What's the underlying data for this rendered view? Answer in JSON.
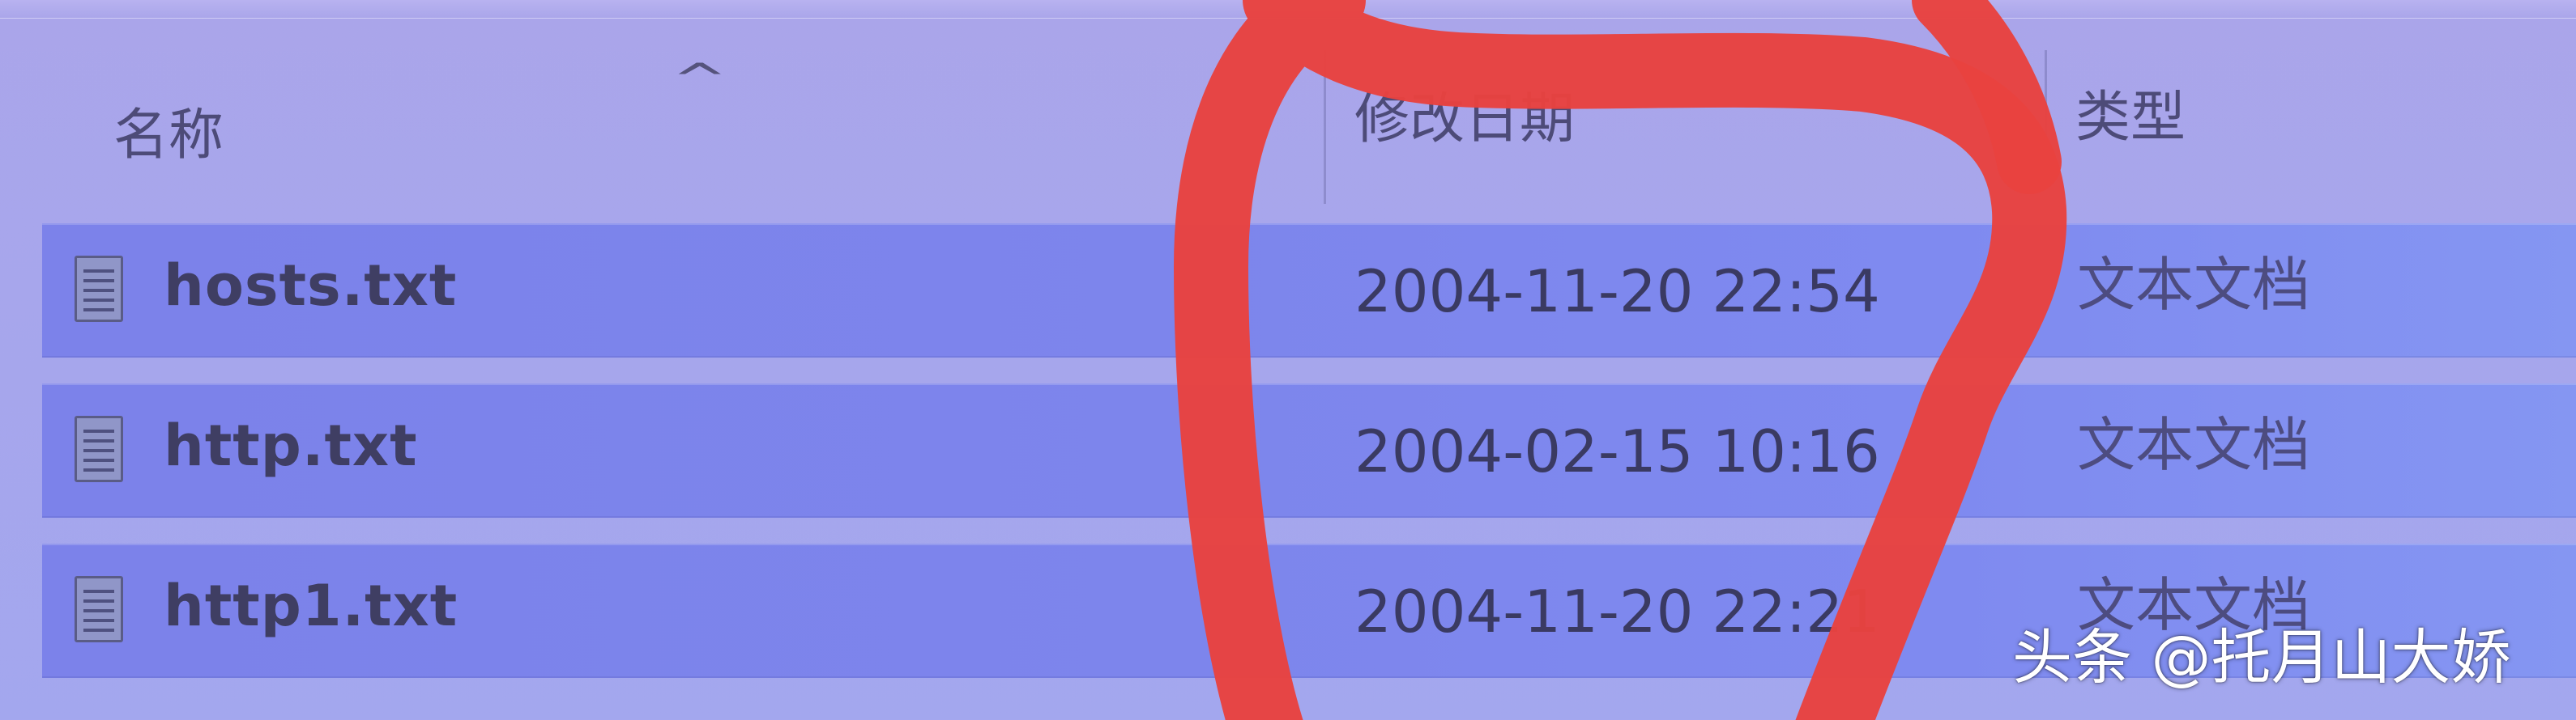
{
  "columns": {
    "name": "名称",
    "date": "修改日期",
    "type": "类型",
    "sort_indicator": "^"
  },
  "files": [
    {
      "name": "hosts.txt",
      "modified": "2004-11-20 22:54",
      "type": "文本文档",
      "icon": "text-file-icon"
    },
    {
      "name": "http.txt",
      "modified": "2004-02-15 10:16",
      "type": "文本文档",
      "icon": "text-file-icon"
    },
    {
      "name": "http1.txt",
      "modified": "2004-11-20 22:21",
      "type": "文本文档",
      "icon": "text-file-icon"
    }
  ],
  "watermark": "头条 @托月山大娇",
  "colors": {
    "background": "#a8a6ec",
    "row_highlight": "#7e86ec",
    "annotation": "#e8423f",
    "text_primary": "#3f3e63"
  }
}
